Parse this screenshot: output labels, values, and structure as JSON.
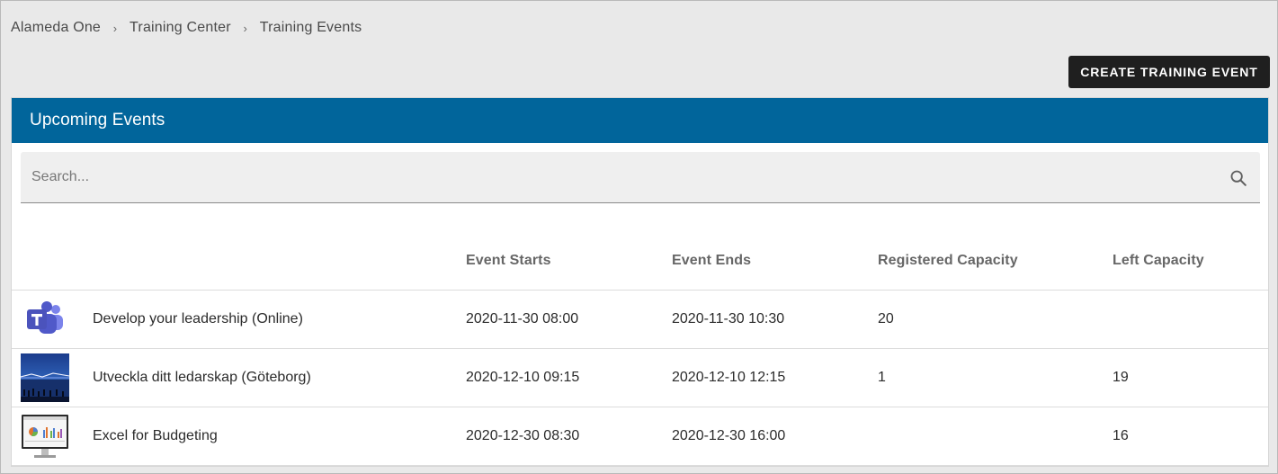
{
  "breadcrumb": {
    "items": [
      "Alameda One",
      "Training Center",
      "Training Events"
    ],
    "separator": "›"
  },
  "actions": {
    "create_label": "CREATE TRAINING EVENT"
  },
  "panel": {
    "title": "Upcoming Events",
    "search_placeholder": "Search..."
  },
  "table": {
    "columns": [
      "",
      "",
      "Event Starts",
      "Event Ends",
      "Registered Capacity",
      "Left Capacity"
    ],
    "rows": [
      {
        "thumbnail": "teams-icon",
        "name": "Develop your leadership (Online)",
        "starts": "2020-11-30 08:00",
        "ends": "2020-11-30 10:30",
        "registered": "20",
        "left": ""
      },
      {
        "thumbnail": "city-bridge-night-photo",
        "name": "Utveckla ditt ledarskap (Göteborg)",
        "starts": "2020-12-10 09:15",
        "ends": "2020-12-10 12:15",
        "registered": "1",
        "left": "19"
      },
      {
        "thumbnail": "spreadsheet-monitor-image",
        "name": "Excel for Budgeting",
        "starts": "2020-12-30 08:30",
        "ends": "2020-12-30 16:00",
        "registered": "",
        "left": "16"
      }
    ]
  },
  "colors": {
    "header_blue": "#01659b",
    "button_dark": "#1f1f1f",
    "page_bg": "#e9e9e9"
  }
}
